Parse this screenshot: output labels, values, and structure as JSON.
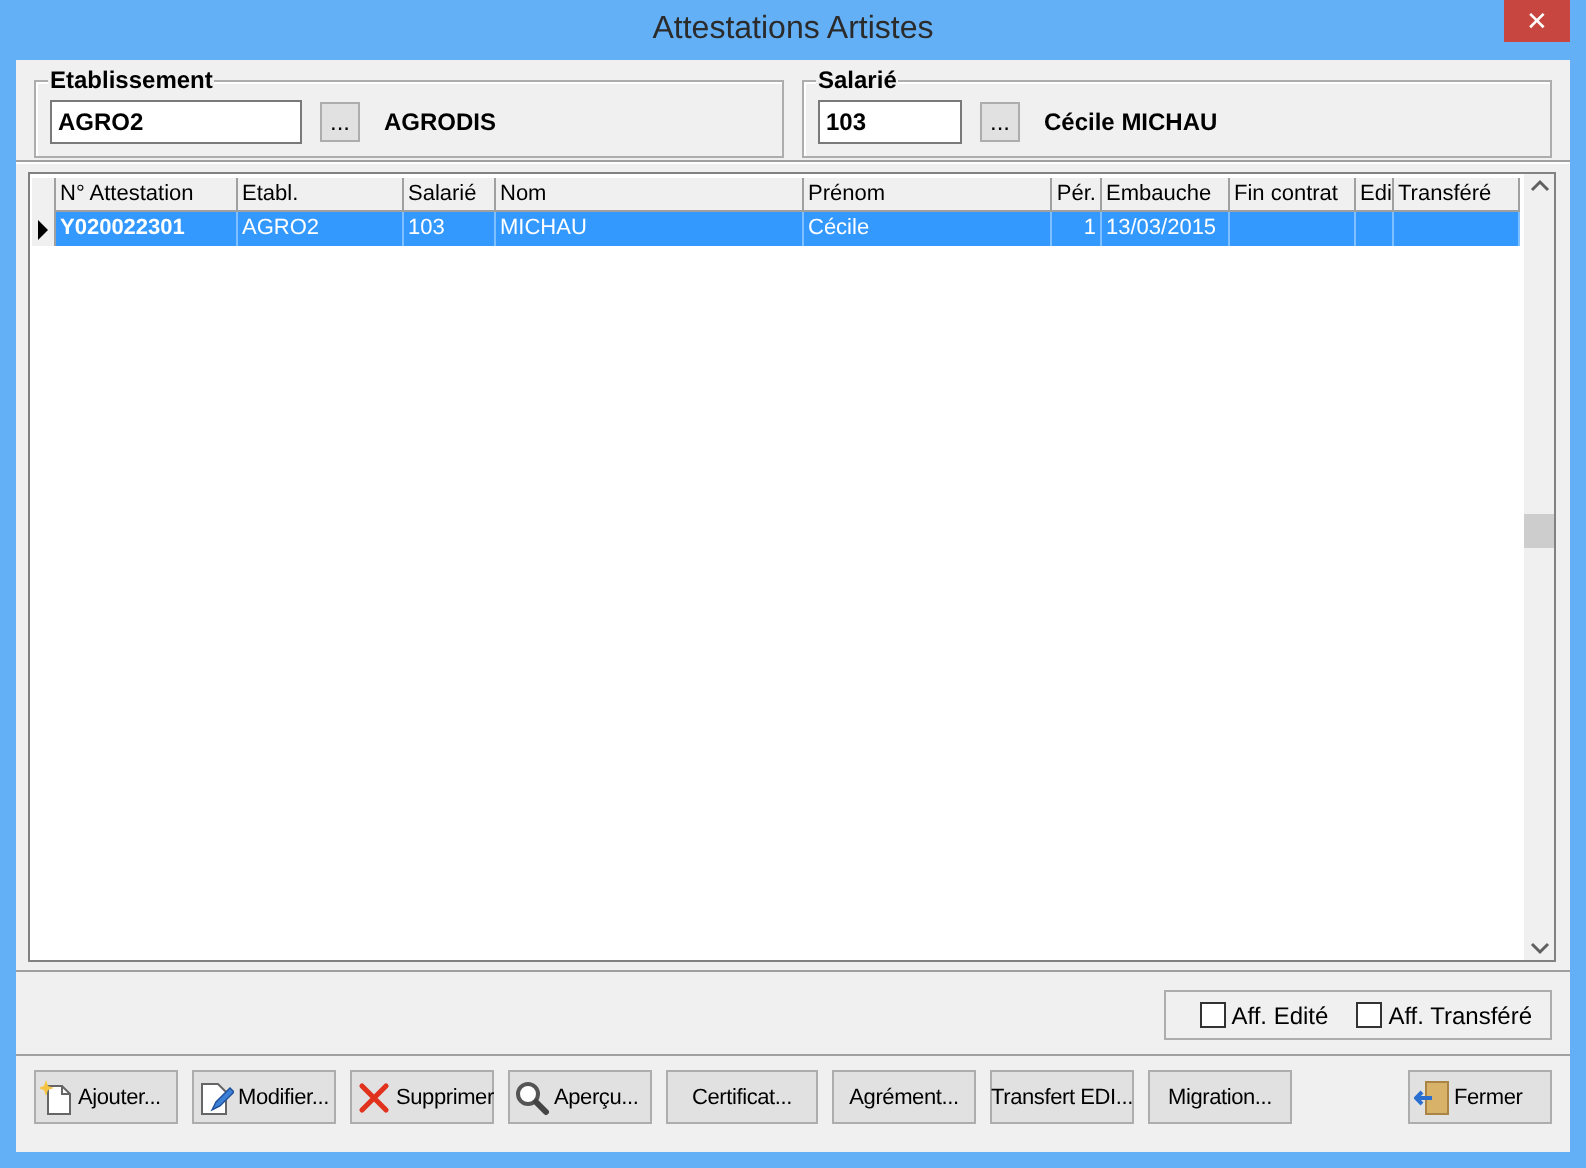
{
  "window": {
    "title": "Attestations Artistes",
    "close": "✕"
  },
  "groups": [
    {
      "label": "Etablissement",
      "value": "AGRO2",
      "browse": "...",
      "name": "AGRODIS"
    },
    {
      "label": "Salarié",
      "value": "103",
      "browse": "...",
      "name": "Cécile MICHAU"
    }
  ],
  "table": {
    "columns": [
      {
        "label": "N° Attestation",
        "kind": "text"
      },
      {
        "label": "Etabl.",
        "kind": "text"
      },
      {
        "label": "Salarié",
        "kind": "text"
      },
      {
        "label": "Nom",
        "kind": "text"
      },
      {
        "label": "Prénom",
        "kind": "text"
      },
      {
        "label": "Pér.",
        "kind": "number"
      },
      {
        "label": "Embauche",
        "kind": "text"
      },
      {
        "label": "Fin contrat",
        "kind": "text"
      },
      {
        "label": "Edi",
        "kind": "text"
      },
      {
        "label": "Transféré",
        "kind": "text"
      }
    ],
    "rows": [
      {
        "selected": true,
        "cells": [
          "Y020022301",
          "AGRO2",
          "103",
          "MICHAU",
          "Cécile",
          "1",
          "13/03/2015",
          "",
          "",
          ""
        ]
      }
    ]
  },
  "filters": [
    {
      "label": "Aff. Edité",
      "checked": false
    },
    {
      "label": "Aff. Transféré",
      "checked": false
    }
  ],
  "buttons": [
    {
      "label": "Ajouter...",
      "kind": "new"
    },
    {
      "label": "Modifier...",
      "kind": "edit"
    },
    {
      "label": "Supprimer",
      "kind": "delete"
    },
    {
      "label": "Aperçu...",
      "kind": "preview"
    },
    {
      "label": "Certificat...",
      "kind": "text"
    },
    {
      "label": "Agrément...",
      "kind": "text"
    },
    {
      "label": "Transfert EDI...",
      "kind": "text"
    },
    {
      "label": "Migration...",
      "kind": "text"
    },
    {
      "label": "Fermer",
      "kind": "close"
    }
  ]
}
